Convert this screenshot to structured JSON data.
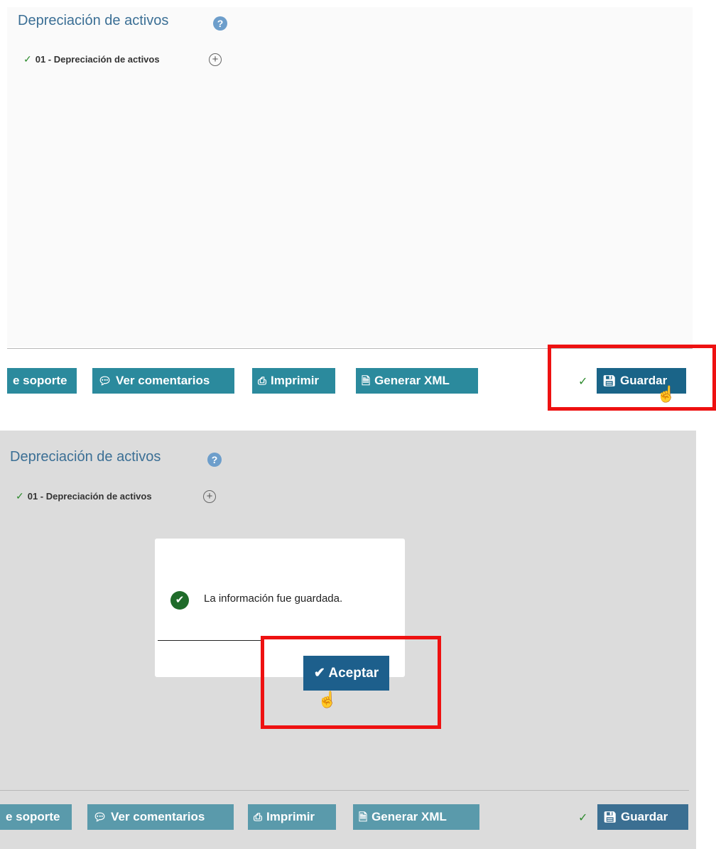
{
  "page": {
    "title": "Depreciación de activos",
    "help_icon": "?",
    "section": {
      "check": "✓",
      "label": "01 - Depreciación de activos",
      "add_icon": "+"
    }
  },
  "toolbar": {
    "soporte_label": "e soporte",
    "comentarios_label": "Ver comentarios",
    "imprimir_label": "Imprimir",
    "xml_label": "Generar XML",
    "saved_check": "✓",
    "guardar_label": "Guardar"
  },
  "dialog": {
    "message": "La información fue guardada.",
    "accept_label": "Aceptar"
  },
  "icons": {
    "comment": "comment-icon",
    "print": "print-icon",
    "xml": "xml-file-icon",
    "save": "floppy-disk-icon",
    "success": "check-circle-icon",
    "cursor": "hand-pointer-icon"
  },
  "colors": {
    "button": "#2b8a9d",
    "save_button": "#1a6488",
    "highlight": "#ee1111",
    "title": "#3b6f95",
    "success": "#1f6b2a"
  }
}
